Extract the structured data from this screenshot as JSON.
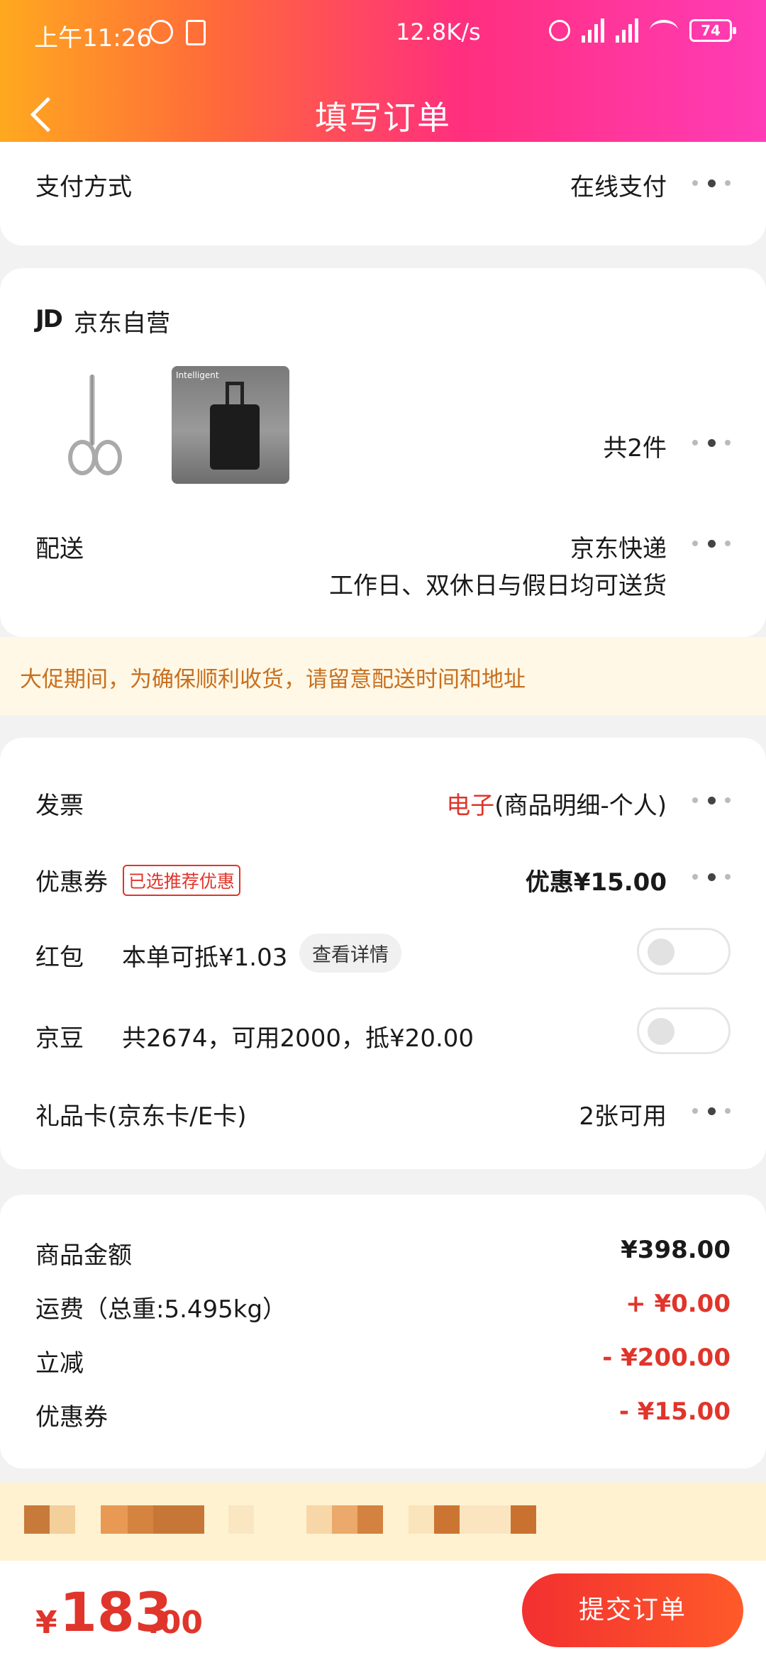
{
  "status_bar": {
    "time": "上午11:26",
    "net_speed": "12.8K/s",
    "battery": "74"
  },
  "header": {
    "title": "填写订单"
  },
  "payment": {
    "label": "支付方式",
    "value": "在线支付"
  },
  "shop": {
    "logo": "JD",
    "name": "京东自营",
    "count": "共2件",
    "products": [
      {
        "icon": "scissors-image"
      },
      {
        "icon": "suitcase-image",
        "brand": "Intelligent"
      }
    ]
  },
  "delivery": {
    "label": "配送",
    "value": "京东快递",
    "note": "工作日、双休日与假日均可送货"
  },
  "notice": {
    "text": "大促期间，为确保顺利收货，请留意配送时间和地址"
  },
  "invoice": {
    "label": "发票",
    "value_highlight": "电子",
    "value_rest": "(商品明细-个人)"
  },
  "coupon": {
    "label": "优惠券",
    "tag": "已选推荐优惠",
    "value": "优惠¥15.00"
  },
  "redpacket": {
    "label": "红包",
    "desc": "本单可抵¥1.03",
    "detail_btn": "查看详情",
    "enabled": false
  },
  "jingdou": {
    "label": "京豆",
    "desc": "共2674，可用2000，抵¥20.00",
    "enabled": false
  },
  "giftcard": {
    "label": "礼品卡(京东卡/E卡)",
    "value": "2张可用"
  },
  "summary": [
    {
      "label": "商品金额",
      "value": "¥398.00",
      "color": "#1a1a1a"
    },
    {
      "label": "运费（总重:5.495kg）",
      "value": "+ ¥0.00",
      "color": "#e0352b"
    },
    {
      "label": "立减",
      "value": "- ¥200.00",
      "color": "#e0352b"
    },
    {
      "label": "优惠券",
      "value": "- ¥15.00",
      "color": "#e0352b"
    }
  ],
  "total": {
    "currency": "¥",
    "integer": "183",
    "decimal": ".00"
  },
  "submit": {
    "label": "提交订单"
  },
  "colors": {
    "accent_red": "#e0352b",
    "header_start": "#ffa91f",
    "header_end": "#ff3cb6",
    "notice_text": "#c87020"
  }
}
